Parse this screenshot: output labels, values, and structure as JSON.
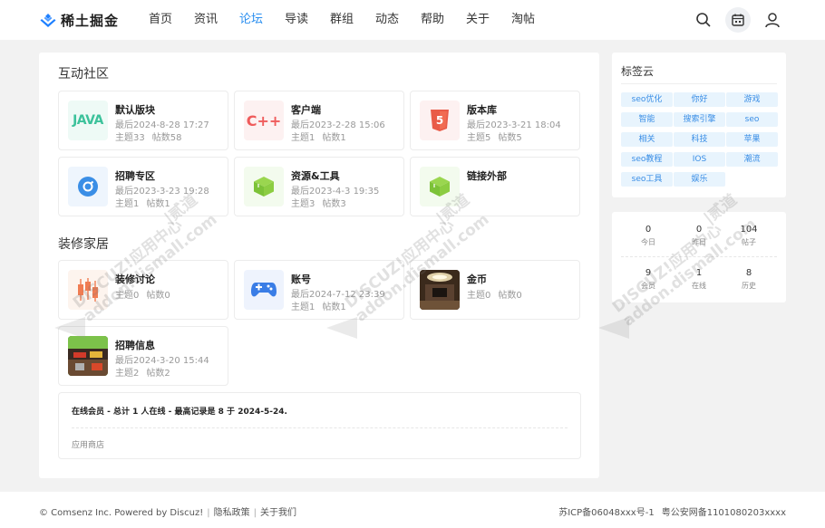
{
  "header": {
    "logo_text": "稀土掘金",
    "nav": [
      {
        "label": "首页"
      },
      {
        "label": "资讯"
      },
      {
        "label": "论坛"
      },
      {
        "label": "导读"
      },
      {
        "label": "群组"
      },
      {
        "label": "动态"
      },
      {
        "label": "帮助"
      },
      {
        "label": "关于"
      },
      {
        "label": "淘帖"
      }
    ],
    "active_nav": "论坛",
    "icons": [
      "search-icon",
      "calendar-icon",
      "user-icon"
    ]
  },
  "sections": [
    {
      "title": "互动社区",
      "forums": [
        {
          "name": "默认版块",
          "last": "最后2024-8-28 17:27",
          "topics": "主题33",
          "posts": "帖数58",
          "icon": "java-icon"
        },
        {
          "name": "客户端",
          "last": "最后2023-2-28 15:06",
          "topics": "主题1",
          "posts": "帖数1",
          "icon": "cpp-icon"
        },
        {
          "name": "版本库",
          "last": "最后2023-3-21 18:04",
          "topics": "主题5",
          "posts": "帖数5",
          "icon": "html5-icon"
        },
        {
          "name": "招聘专区",
          "last": "最后2023-3-23 19:28",
          "topics": "主题1",
          "posts": "帖数1",
          "icon": "compass-icon"
        },
        {
          "name": "资源&工具",
          "last": "最后2023-4-3 19:35",
          "topics": "主题3",
          "posts": "帖数3",
          "icon": "cube-icon"
        },
        {
          "name": "链接外部",
          "last": "",
          "topics": "",
          "posts": "",
          "icon": "cube-icon"
        }
      ]
    },
    {
      "title": "装修家居",
      "forums": [
        {
          "name": "装修讨论",
          "last": "",
          "topics": "主题0",
          "posts": "帖数0",
          "icon": "candlestick-icon"
        },
        {
          "name": "账号",
          "last": "最后2024-7-12 23:39",
          "topics": "主题1",
          "posts": "帖数1",
          "icon": "gamepad-icon"
        },
        {
          "name": "金币",
          "last": "",
          "topics": "主题0",
          "posts": "帖数0",
          "icon": "room-photo"
        },
        {
          "name": "招聘信息",
          "last": "最后2024-3-20 15:44",
          "topics": "主题2",
          "posts": "帖数2",
          "icon": "game-screenshot"
        }
      ]
    }
  ],
  "online": {
    "text": "在线会员 - 总计 1 人在线 - 最高记录是 8 于 2024-5-24.",
    "app_store": "应用商店"
  },
  "tag_cloud": {
    "title": "标签云",
    "tags": [
      "seo优化",
      "你好",
      "游戏",
      "智能",
      "搜索引擎",
      "seo",
      "相关",
      "科技",
      "苹果",
      "seo教程",
      "IOS",
      "潮流",
      "seo工具",
      "娱乐"
    ]
  },
  "stats": [
    {
      "value": "0",
      "label": "今日"
    },
    {
      "value": "0",
      "label": "昨日"
    },
    {
      "value": "104",
      "label": "帖子"
    },
    {
      "value": "9",
      "label": "会员"
    },
    {
      "value": "1",
      "label": "在线"
    },
    {
      "value": "8",
      "label": "历史"
    }
  ],
  "footer": {
    "copyright": "© Comsenz Inc. Powered by Discuz!",
    "links": [
      "隐私政策",
      "关于我们"
    ],
    "icp": "苏ICP备06048xxx号-1",
    "police": "粤公安网备1101080203xxxx"
  },
  "watermark": {
    "line1": "DISCUZ!应用中心",
    "line2": "addon.dismall.com",
    "brand": "|贰道"
  },
  "colors": {
    "accent": "#2b8ff0",
    "tag_bg": "#e8f4fd",
    "tag_text": "#3a8ee6"
  }
}
